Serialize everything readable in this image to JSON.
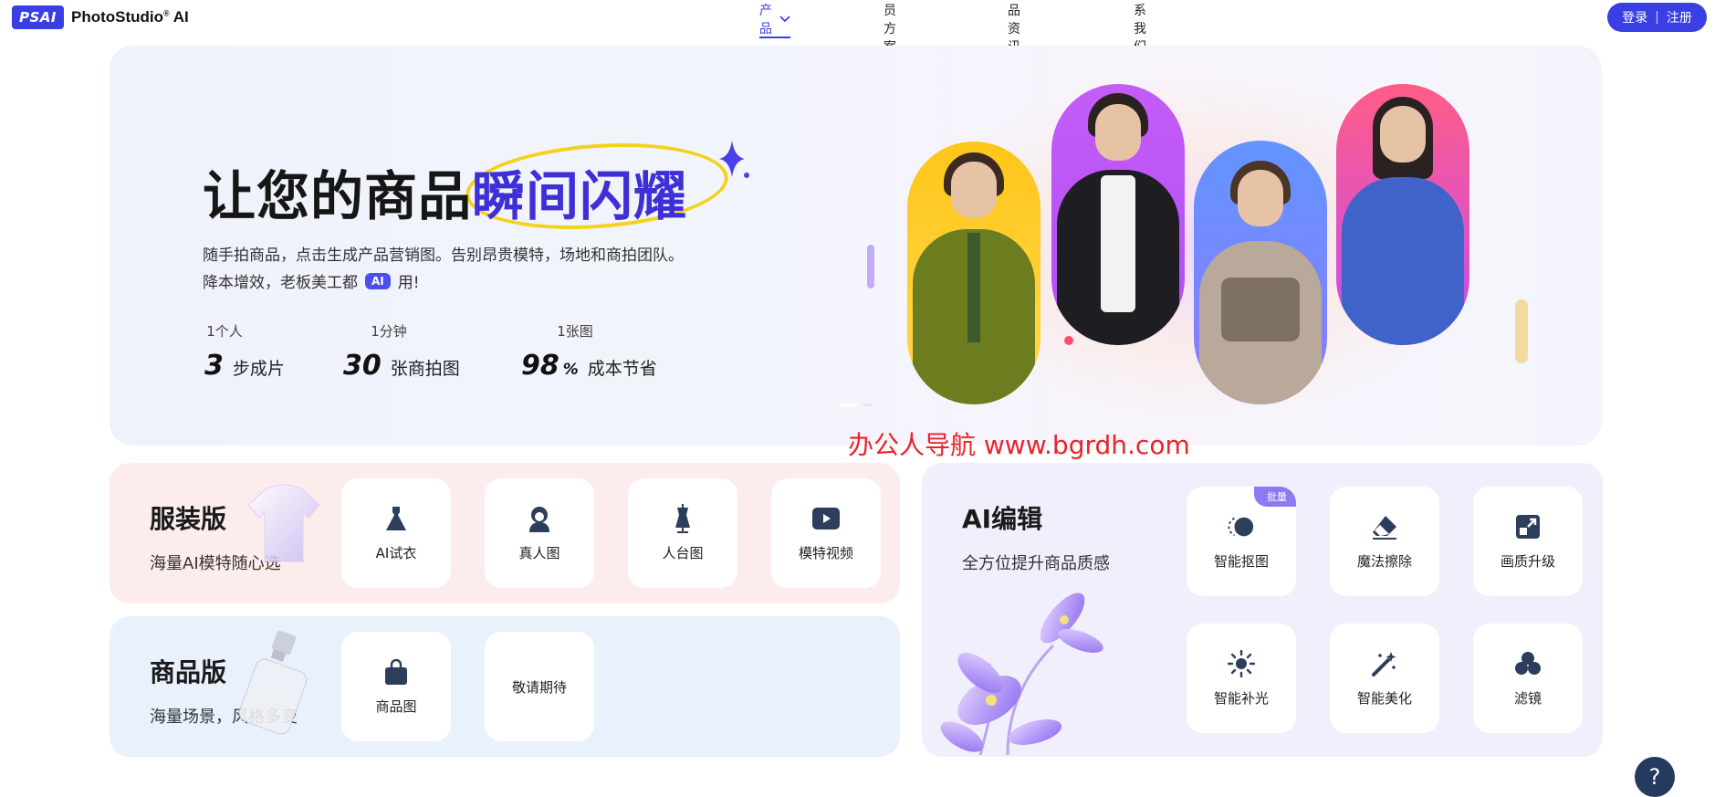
{
  "header": {
    "logo_mark": "PSAI",
    "logo_text": "PhotoStudio",
    "logo_sup": "®",
    "logo_suffix": " AI",
    "nav": [
      {
        "label": "产品"
      },
      {
        "label": "会员方案"
      },
      {
        "label": "产品资讯"
      },
      {
        "label": "联系我们"
      }
    ],
    "login_label": "登录",
    "register_label": "注册",
    "separator": "|"
  },
  "hero": {
    "title_main": "让您的商品",
    "title_highlight": "瞬间闪耀",
    "subtitle_line1": "随手拍商品，点击生成产品营销图。告别昂贵模特，场地和商拍团队。",
    "subtitle_line2_pre": "降本增效，老板美工都",
    "subtitle_ai": "AI",
    "subtitle_line2_post": "用!",
    "stats": [
      {
        "top": "1个人",
        "num": "3",
        "unit": "",
        "label": "步成片"
      },
      {
        "top": "1分钟",
        "num": "30",
        "unit": "",
        "label": "张商拍图"
      },
      {
        "top": "1张图",
        "num": "98",
        "unit": "%",
        "label": "成本节省"
      }
    ]
  },
  "watermark": "办公人导航 www.bgrdh.com",
  "apparel": {
    "title": "服装版",
    "subtitle": "海量AI模特随心选",
    "tiles": [
      {
        "label": "AI试衣",
        "icon": "dress-icon"
      },
      {
        "label": "真人图",
        "icon": "person-icon"
      },
      {
        "label": "人台图",
        "icon": "mannequin-icon"
      },
      {
        "label": "模特视频",
        "icon": "play-icon"
      }
    ]
  },
  "product": {
    "title": "商品版",
    "subtitle": "海量场景，风格多变",
    "tiles": [
      {
        "label": "商品图",
        "icon": "shopping-bag-icon"
      },
      {
        "label": "敬请期待"
      }
    ]
  },
  "ai_edit": {
    "title": "AI编辑",
    "subtitle": "全方位提升商品质感",
    "badge": "批量",
    "tiles": [
      {
        "label": "智能抠图",
        "icon": "cutout-icon"
      },
      {
        "label": "魔法擦除",
        "icon": "eraser-icon"
      },
      {
        "label": "画质升级",
        "icon": "upscale-icon"
      },
      {
        "label": "智能补光",
        "icon": "sun-icon"
      },
      {
        "label": "智能美化",
        "icon": "magic-wand-icon"
      },
      {
        "label": "滤镜",
        "icon": "filter-icon"
      }
    ]
  },
  "help": {
    "label": "?"
  },
  "colors": {
    "brand": "#3a3fe4",
    "highlight": "#3f2fd6",
    "ring": "#f4d21c",
    "apparel_bg": "#fdecec",
    "product_bg": "#e9f1fd",
    "ai_bg": "#f2effc",
    "icon": "#2c3e5c"
  }
}
